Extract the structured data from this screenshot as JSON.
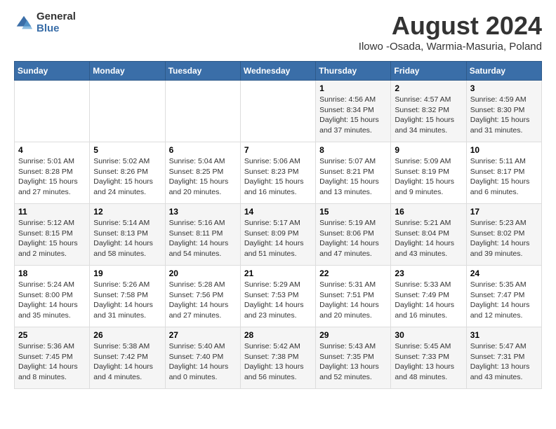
{
  "logo": {
    "general": "General",
    "blue": "Blue"
  },
  "title": "August 2024",
  "subtitle": "Ilowo -Osada, Warmia-Masuria, Poland",
  "weekdays": [
    "Sunday",
    "Monday",
    "Tuesday",
    "Wednesday",
    "Thursday",
    "Friday",
    "Saturday"
  ],
  "weeks": [
    [
      {
        "day": "",
        "info": ""
      },
      {
        "day": "",
        "info": ""
      },
      {
        "day": "",
        "info": ""
      },
      {
        "day": "",
        "info": ""
      },
      {
        "day": "1",
        "info": "Sunrise: 4:56 AM\nSunset: 8:34 PM\nDaylight: 15 hours\nand 37 minutes."
      },
      {
        "day": "2",
        "info": "Sunrise: 4:57 AM\nSunset: 8:32 PM\nDaylight: 15 hours\nand 34 minutes."
      },
      {
        "day": "3",
        "info": "Sunrise: 4:59 AM\nSunset: 8:30 PM\nDaylight: 15 hours\nand 31 minutes."
      }
    ],
    [
      {
        "day": "4",
        "info": "Sunrise: 5:01 AM\nSunset: 8:28 PM\nDaylight: 15 hours\nand 27 minutes."
      },
      {
        "day": "5",
        "info": "Sunrise: 5:02 AM\nSunset: 8:26 PM\nDaylight: 15 hours\nand 24 minutes."
      },
      {
        "day": "6",
        "info": "Sunrise: 5:04 AM\nSunset: 8:25 PM\nDaylight: 15 hours\nand 20 minutes."
      },
      {
        "day": "7",
        "info": "Sunrise: 5:06 AM\nSunset: 8:23 PM\nDaylight: 15 hours\nand 16 minutes."
      },
      {
        "day": "8",
        "info": "Sunrise: 5:07 AM\nSunset: 8:21 PM\nDaylight: 15 hours\nand 13 minutes."
      },
      {
        "day": "9",
        "info": "Sunrise: 5:09 AM\nSunset: 8:19 PM\nDaylight: 15 hours\nand 9 minutes."
      },
      {
        "day": "10",
        "info": "Sunrise: 5:11 AM\nSunset: 8:17 PM\nDaylight: 15 hours\nand 6 minutes."
      }
    ],
    [
      {
        "day": "11",
        "info": "Sunrise: 5:12 AM\nSunset: 8:15 PM\nDaylight: 15 hours\nand 2 minutes."
      },
      {
        "day": "12",
        "info": "Sunrise: 5:14 AM\nSunset: 8:13 PM\nDaylight: 14 hours\nand 58 minutes."
      },
      {
        "day": "13",
        "info": "Sunrise: 5:16 AM\nSunset: 8:11 PM\nDaylight: 14 hours\nand 54 minutes."
      },
      {
        "day": "14",
        "info": "Sunrise: 5:17 AM\nSunset: 8:09 PM\nDaylight: 14 hours\nand 51 minutes."
      },
      {
        "day": "15",
        "info": "Sunrise: 5:19 AM\nSunset: 8:06 PM\nDaylight: 14 hours\nand 47 minutes."
      },
      {
        "day": "16",
        "info": "Sunrise: 5:21 AM\nSunset: 8:04 PM\nDaylight: 14 hours\nand 43 minutes."
      },
      {
        "day": "17",
        "info": "Sunrise: 5:23 AM\nSunset: 8:02 PM\nDaylight: 14 hours\nand 39 minutes."
      }
    ],
    [
      {
        "day": "18",
        "info": "Sunrise: 5:24 AM\nSunset: 8:00 PM\nDaylight: 14 hours\nand 35 minutes."
      },
      {
        "day": "19",
        "info": "Sunrise: 5:26 AM\nSunset: 7:58 PM\nDaylight: 14 hours\nand 31 minutes."
      },
      {
        "day": "20",
        "info": "Sunrise: 5:28 AM\nSunset: 7:56 PM\nDaylight: 14 hours\nand 27 minutes."
      },
      {
        "day": "21",
        "info": "Sunrise: 5:29 AM\nSunset: 7:53 PM\nDaylight: 14 hours\nand 23 minutes."
      },
      {
        "day": "22",
        "info": "Sunrise: 5:31 AM\nSunset: 7:51 PM\nDaylight: 14 hours\nand 20 minutes."
      },
      {
        "day": "23",
        "info": "Sunrise: 5:33 AM\nSunset: 7:49 PM\nDaylight: 14 hours\nand 16 minutes."
      },
      {
        "day": "24",
        "info": "Sunrise: 5:35 AM\nSunset: 7:47 PM\nDaylight: 14 hours\nand 12 minutes."
      }
    ],
    [
      {
        "day": "25",
        "info": "Sunrise: 5:36 AM\nSunset: 7:45 PM\nDaylight: 14 hours\nand 8 minutes."
      },
      {
        "day": "26",
        "info": "Sunrise: 5:38 AM\nSunset: 7:42 PM\nDaylight: 14 hours\nand 4 minutes."
      },
      {
        "day": "27",
        "info": "Sunrise: 5:40 AM\nSunset: 7:40 PM\nDaylight: 14 hours\nand 0 minutes."
      },
      {
        "day": "28",
        "info": "Sunrise: 5:42 AM\nSunset: 7:38 PM\nDaylight: 13 hours\nand 56 minutes."
      },
      {
        "day": "29",
        "info": "Sunrise: 5:43 AM\nSunset: 7:35 PM\nDaylight: 13 hours\nand 52 minutes."
      },
      {
        "day": "30",
        "info": "Sunrise: 5:45 AM\nSunset: 7:33 PM\nDaylight: 13 hours\nand 48 minutes."
      },
      {
        "day": "31",
        "info": "Sunrise: 5:47 AM\nSunset: 7:31 PM\nDaylight: 13 hours\nand 43 minutes."
      }
    ]
  ]
}
